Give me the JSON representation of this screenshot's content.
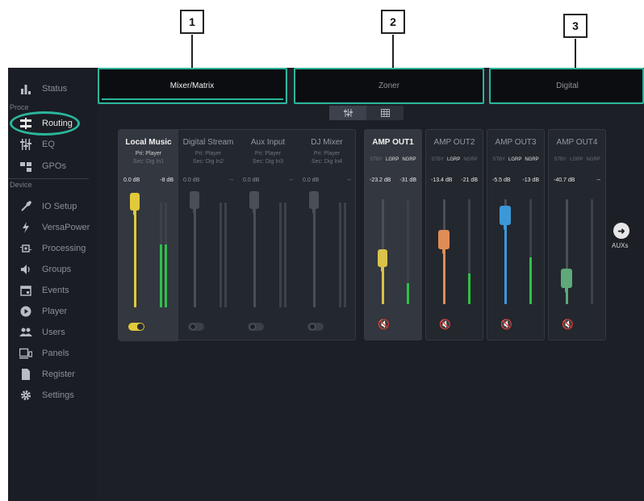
{
  "callouts": [
    "1",
    "2",
    "3"
  ],
  "sidebar": {
    "items": [
      {
        "label": "Status",
        "icon": "bar-chart-icon"
      },
      {
        "label": "Routing",
        "icon": "routing-icon",
        "active": true
      },
      {
        "label": "EQ",
        "icon": "eq-icon"
      },
      {
        "label": "GPOs",
        "icon": "gpo-icon"
      },
      {
        "label": "IO Setup",
        "icon": "wrench-icon"
      },
      {
        "label": "VersaPower",
        "icon": "lightning-icon"
      },
      {
        "label": "Processing",
        "icon": "chip-icon"
      },
      {
        "label": "Groups",
        "icon": "speaker-icon"
      },
      {
        "label": "Events",
        "icon": "calendar-icon"
      },
      {
        "label": "Player",
        "icon": "play-icon"
      },
      {
        "label": "Users",
        "icon": "users-icon"
      },
      {
        "label": "Panels",
        "icon": "panels-icon"
      },
      {
        "label": "Register",
        "icon": "document-icon"
      },
      {
        "label": "Settings",
        "icon": "gear-icon"
      }
    ],
    "section_top": "Proce",
    "section_device": "Device"
  },
  "tabs": [
    {
      "label": "Mixer/Matrix",
      "active": true
    },
    {
      "label": "Zoner"
    },
    {
      "label": "Digital"
    }
  ],
  "view_toggle": {
    "selected": "mixer-view-icon",
    "other": "grid-view-icon"
  },
  "inputs": [
    {
      "name": "Local Music",
      "pri": "Pri: Player",
      "sec": "Sec: Dig In1",
      "db_left": "0.0 dB",
      "db_right": "-8 dB",
      "selected": true,
      "toggle": "on",
      "color": "#e2c93a",
      "level": 1.0,
      "meter": 0.55
    },
    {
      "name": "Digital Stream",
      "pri": "Pri: Player",
      "sec": "Sec: Dig In2",
      "db_left": "0.0 dB",
      "db_right": "--",
      "toggle": "off",
      "color": "#4a4e55",
      "level": 1.0,
      "meter": 0
    },
    {
      "name": "Aux Input",
      "pri": "Pri: Player",
      "sec": "Sec: Dig In3",
      "db_left": "0.0 dB",
      "db_right": "--",
      "toggle": "off",
      "color": "#4a4e55",
      "level": 1.0,
      "meter": 0
    },
    {
      "name": "DJ Mixer",
      "pri": "Pri: Player",
      "sec": "Sec: Dig In4",
      "db_left": "0.0 dB",
      "db_right": "--",
      "toggle": "off",
      "color": "#4a4e55",
      "level": 1.0,
      "meter": 0
    }
  ],
  "outputs": [
    {
      "name": "AMP OUT1",
      "groups": [
        "STBY",
        "LGRP",
        "NGRP"
      ],
      "lit": [
        false,
        true,
        true
      ],
      "db_left": "-23.2 dB",
      "db_right": "-31 dB",
      "selected": true,
      "color": "#d9c34a",
      "level": 0.45,
      "meter": 0.2,
      "mute_orange": false
    },
    {
      "name": "AMP OUT2",
      "groups": [
        "STBY",
        "LGRP",
        "NGRP"
      ],
      "lit": [
        false,
        true,
        false
      ],
      "db_left": "-13.4 dB",
      "db_right": "-21 dB",
      "color": "#e08c55",
      "level": 0.65,
      "meter": 0.3,
      "mute_orange": false
    },
    {
      "name": "AMP OUT3",
      "groups": [
        "STBY",
        "LGRP",
        "NGRP"
      ],
      "lit": [
        false,
        true,
        true
      ],
      "db_left": "-5.5 dB",
      "db_right": "-13 dB",
      "color": "#3d98d8",
      "level": 0.85,
      "meter": 0.45,
      "mute_orange": false
    },
    {
      "name": "AMP OUT4",
      "groups": [
        "STBY",
        "LGRP",
        "NGRP"
      ],
      "lit": [
        false,
        false,
        false
      ],
      "db_left": "-40.7 dB",
      "db_right": "--",
      "color": "#5fa87a",
      "level": 0.25,
      "meter": 0,
      "mute_orange": true
    }
  ],
  "aux": {
    "label": "AUXs"
  }
}
